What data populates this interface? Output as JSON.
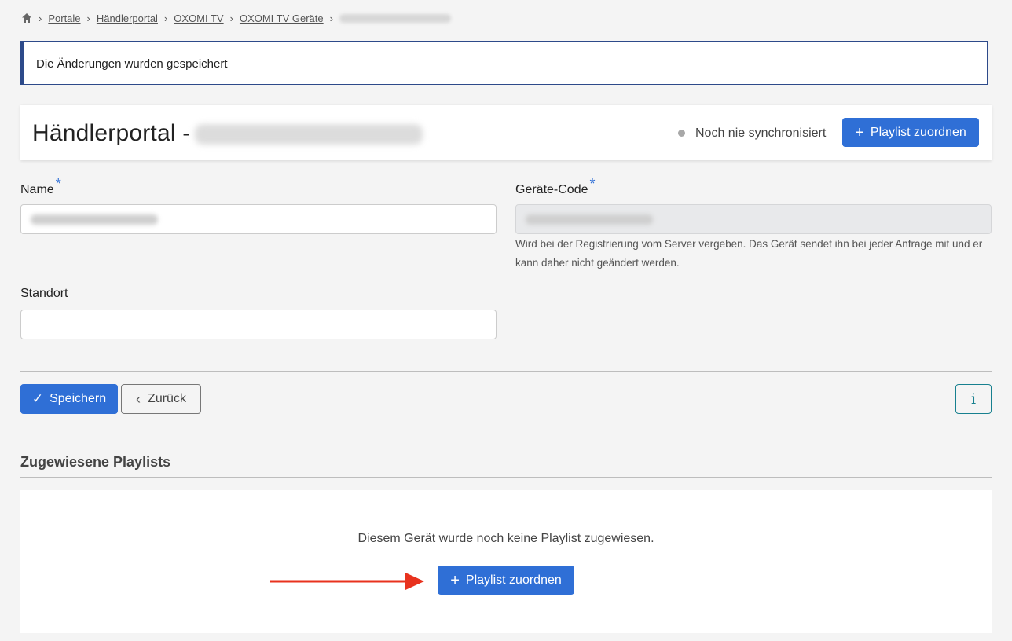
{
  "breadcrumb": {
    "home_icon": "home-icon",
    "items": [
      "Portale",
      "Händlerportal",
      "OXOMI TV",
      "OXOMI TV Geräte"
    ],
    "separator": "›"
  },
  "alert": {
    "message": "Die Änderungen wurden gespeichert"
  },
  "header": {
    "title": "Händlerportal -",
    "sync_status": "Noch nie synchronisiert",
    "assign_button": "Playlist zuordnen"
  },
  "form": {
    "name_label": "Name",
    "required_marker": "*",
    "device_code_label": "Geräte-Code",
    "device_code_help": "Wird bei der Registrierung vom Server vergeben. Das Gerät sendet ihn bei jeder Anfrage mit und er kann daher nicht geändert werden.",
    "location_label": "Standort",
    "location_value": ""
  },
  "actions": {
    "save_label": "Speichern",
    "back_label": "Zurück",
    "info_label": "i"
  },
  "playlists": {
    "section_title": "Zugewiesene Playlists",
    "empty_message": "Diesem Gerät wurde noch keine Playlist zugewiesen.",
    "assign_button": "Playlist zuordnen"
  },
  "colors": {
    "primary": "#2f6fd6",
    "info": "#17808f",
    "alert_border": "#2d4a8a",
    "arrow": "#e8321e"
  }
}
